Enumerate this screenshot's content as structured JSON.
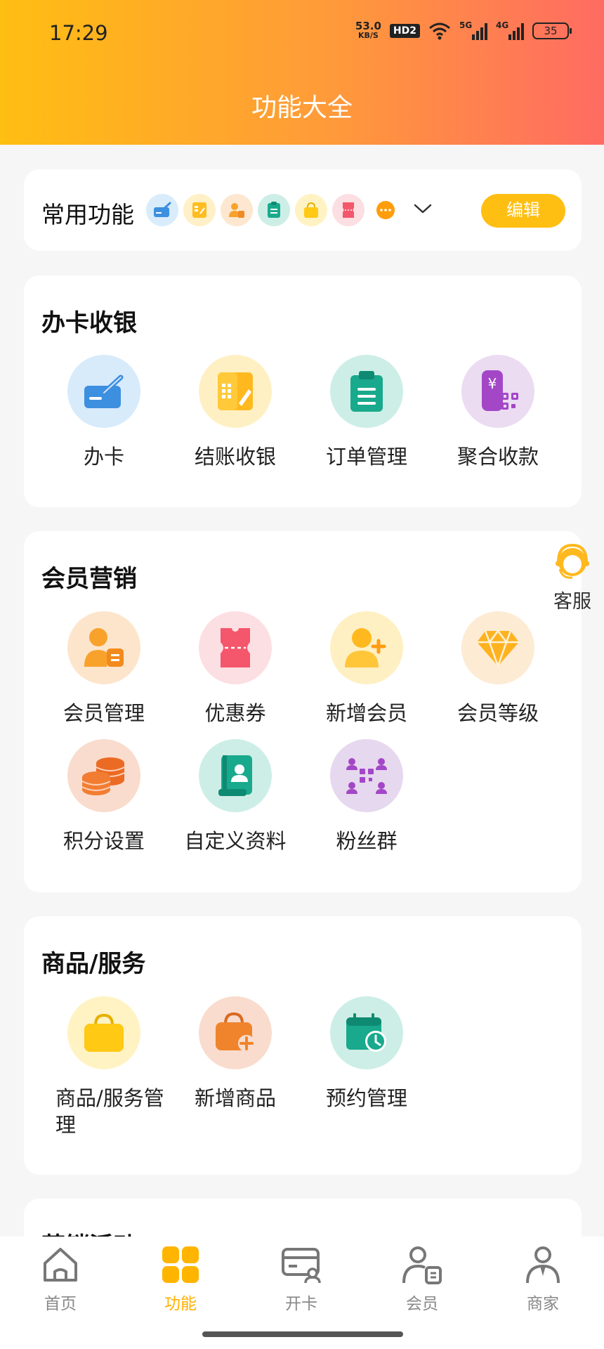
{
  "status": {
    "time": "17:29",
    "speed_value": "53.0",
    "speed_unit": "KB/S",
    "hd": "HD2",
    "net1": "5G",
    "net2": "4G",
    "battery": "35"
  },
  "page_title": "功能大全",
  "favorites": {
    "title": "常用功能",
    "edit_label": "编辑",
    "icons": [
      "card-icon",
      "checkout-icon",
      "member-icon",
      "order-icon",
      "bag-icon",
      "coupon-icon",
      "more-icon",
      "chevron-down-icon"
    ]
  },
  "sections": [
    {
      "title": "办卡收银",
      "items": [
        "办卡",
        "结账收银",
        "订单管理",
        "聚合收款"
      ]
    },
    {
      "title": "会员营销",
      "items": [
        "会员管理",
        "优惠券",
        "新增会员",
        "会员等级",
        "积分设置",
        "自定义资料",
        "粉丝群"
      ]
    },
    {
      "title": "商品/服务",
      "items": [
        "商品/服务管理",
        "新增商品",
        "预约管理"
      ]
    },
    {
      "title": "营销活动"
    }
  ],
  "customer_service": "客服",
  "tabbar": [
    {
      "label": "首页",
      "active": false
    },
    {
      "label": "功能",
      "active": true
    },
    {
      "label": "开卡",
      "active": false
    },
    {
      "label": "会员",
      "active": false
    },
    {
      "label": "商家",
      "active": false
    }
  ],
  "colors": {
    "accent": "#ffbe12",
    "gradient_end": "#ff6b62",
    "active_tab": "#ffb000"
  }
}
